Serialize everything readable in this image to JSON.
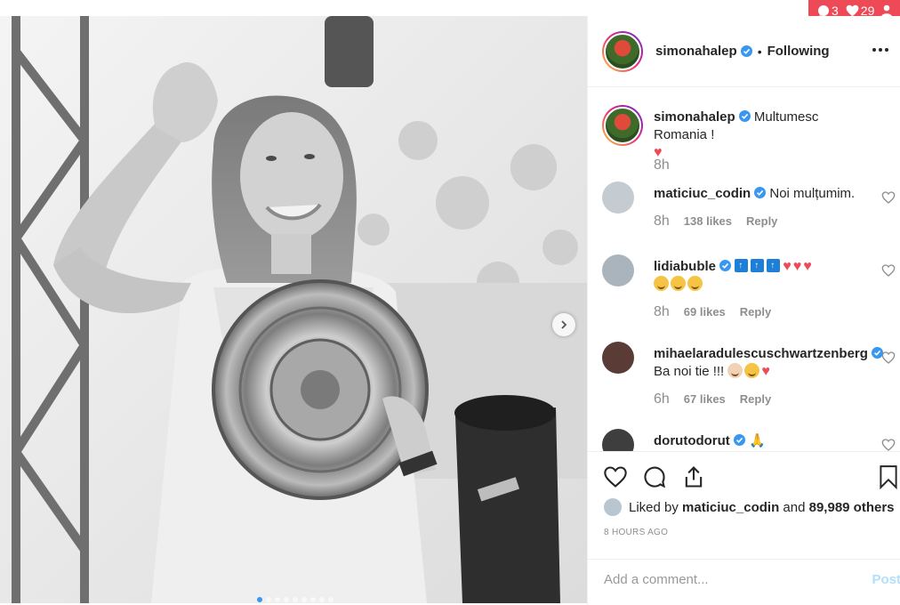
{
  "notifications": {
    "comments_count": "3",
    "likes_count": "29"
  },
  "post": {
    "username": "simonahalep",
    "following_label": "Following",
    "dot_separator": "•",
    "carousel": {
      "total_slides": 9,
      "active_index": 0
    }
  },
  "comments": [
    {
      "username": "simonahalep",
      "text": "Multumesc Romania !",
      "time": "8h",
      "likes": "",
      "reply": ""
    },
    {
      "username": "maticiuc_codin",
      "text": "Noi mulțumim.",
      "time": "8h",
      "likes": "138 likes",
      "reply": "Reply"
    },
    {
      "username": "lidiabuble",
      "text": "",
      "time": "8h",
      "likes": "69 likes",
      "reply": "Reply"
    },
    {
      "username": "mihaelaradulescuschwartzenberg",
      "text": "Ba noi tie !!!",
      "time": "6h",
      "likes": "67 likes",
      "reply": "Reply"
    },
    {
      "username": "dorutodorut",
      "text": "",
      "time": "",
      "likes": "",
      "reply": ""
    }
  ],
  "likes": {
    "prefix": "Liked by",
    "user": "maticiuc_codin",
    "middle": "and",
    "others": "89,989 others"
  },
  "timestamp": "8 HOURS AGO",
  "add_comment": {
    "placeholder": "Add a comment...",
    "post_label": "Post"
  },
  "colors": {
    "accent_red": "#ed4956",
    "verified_blue": "#3897f0",
    "post_disabled": "#b2dffc"
  }
}
